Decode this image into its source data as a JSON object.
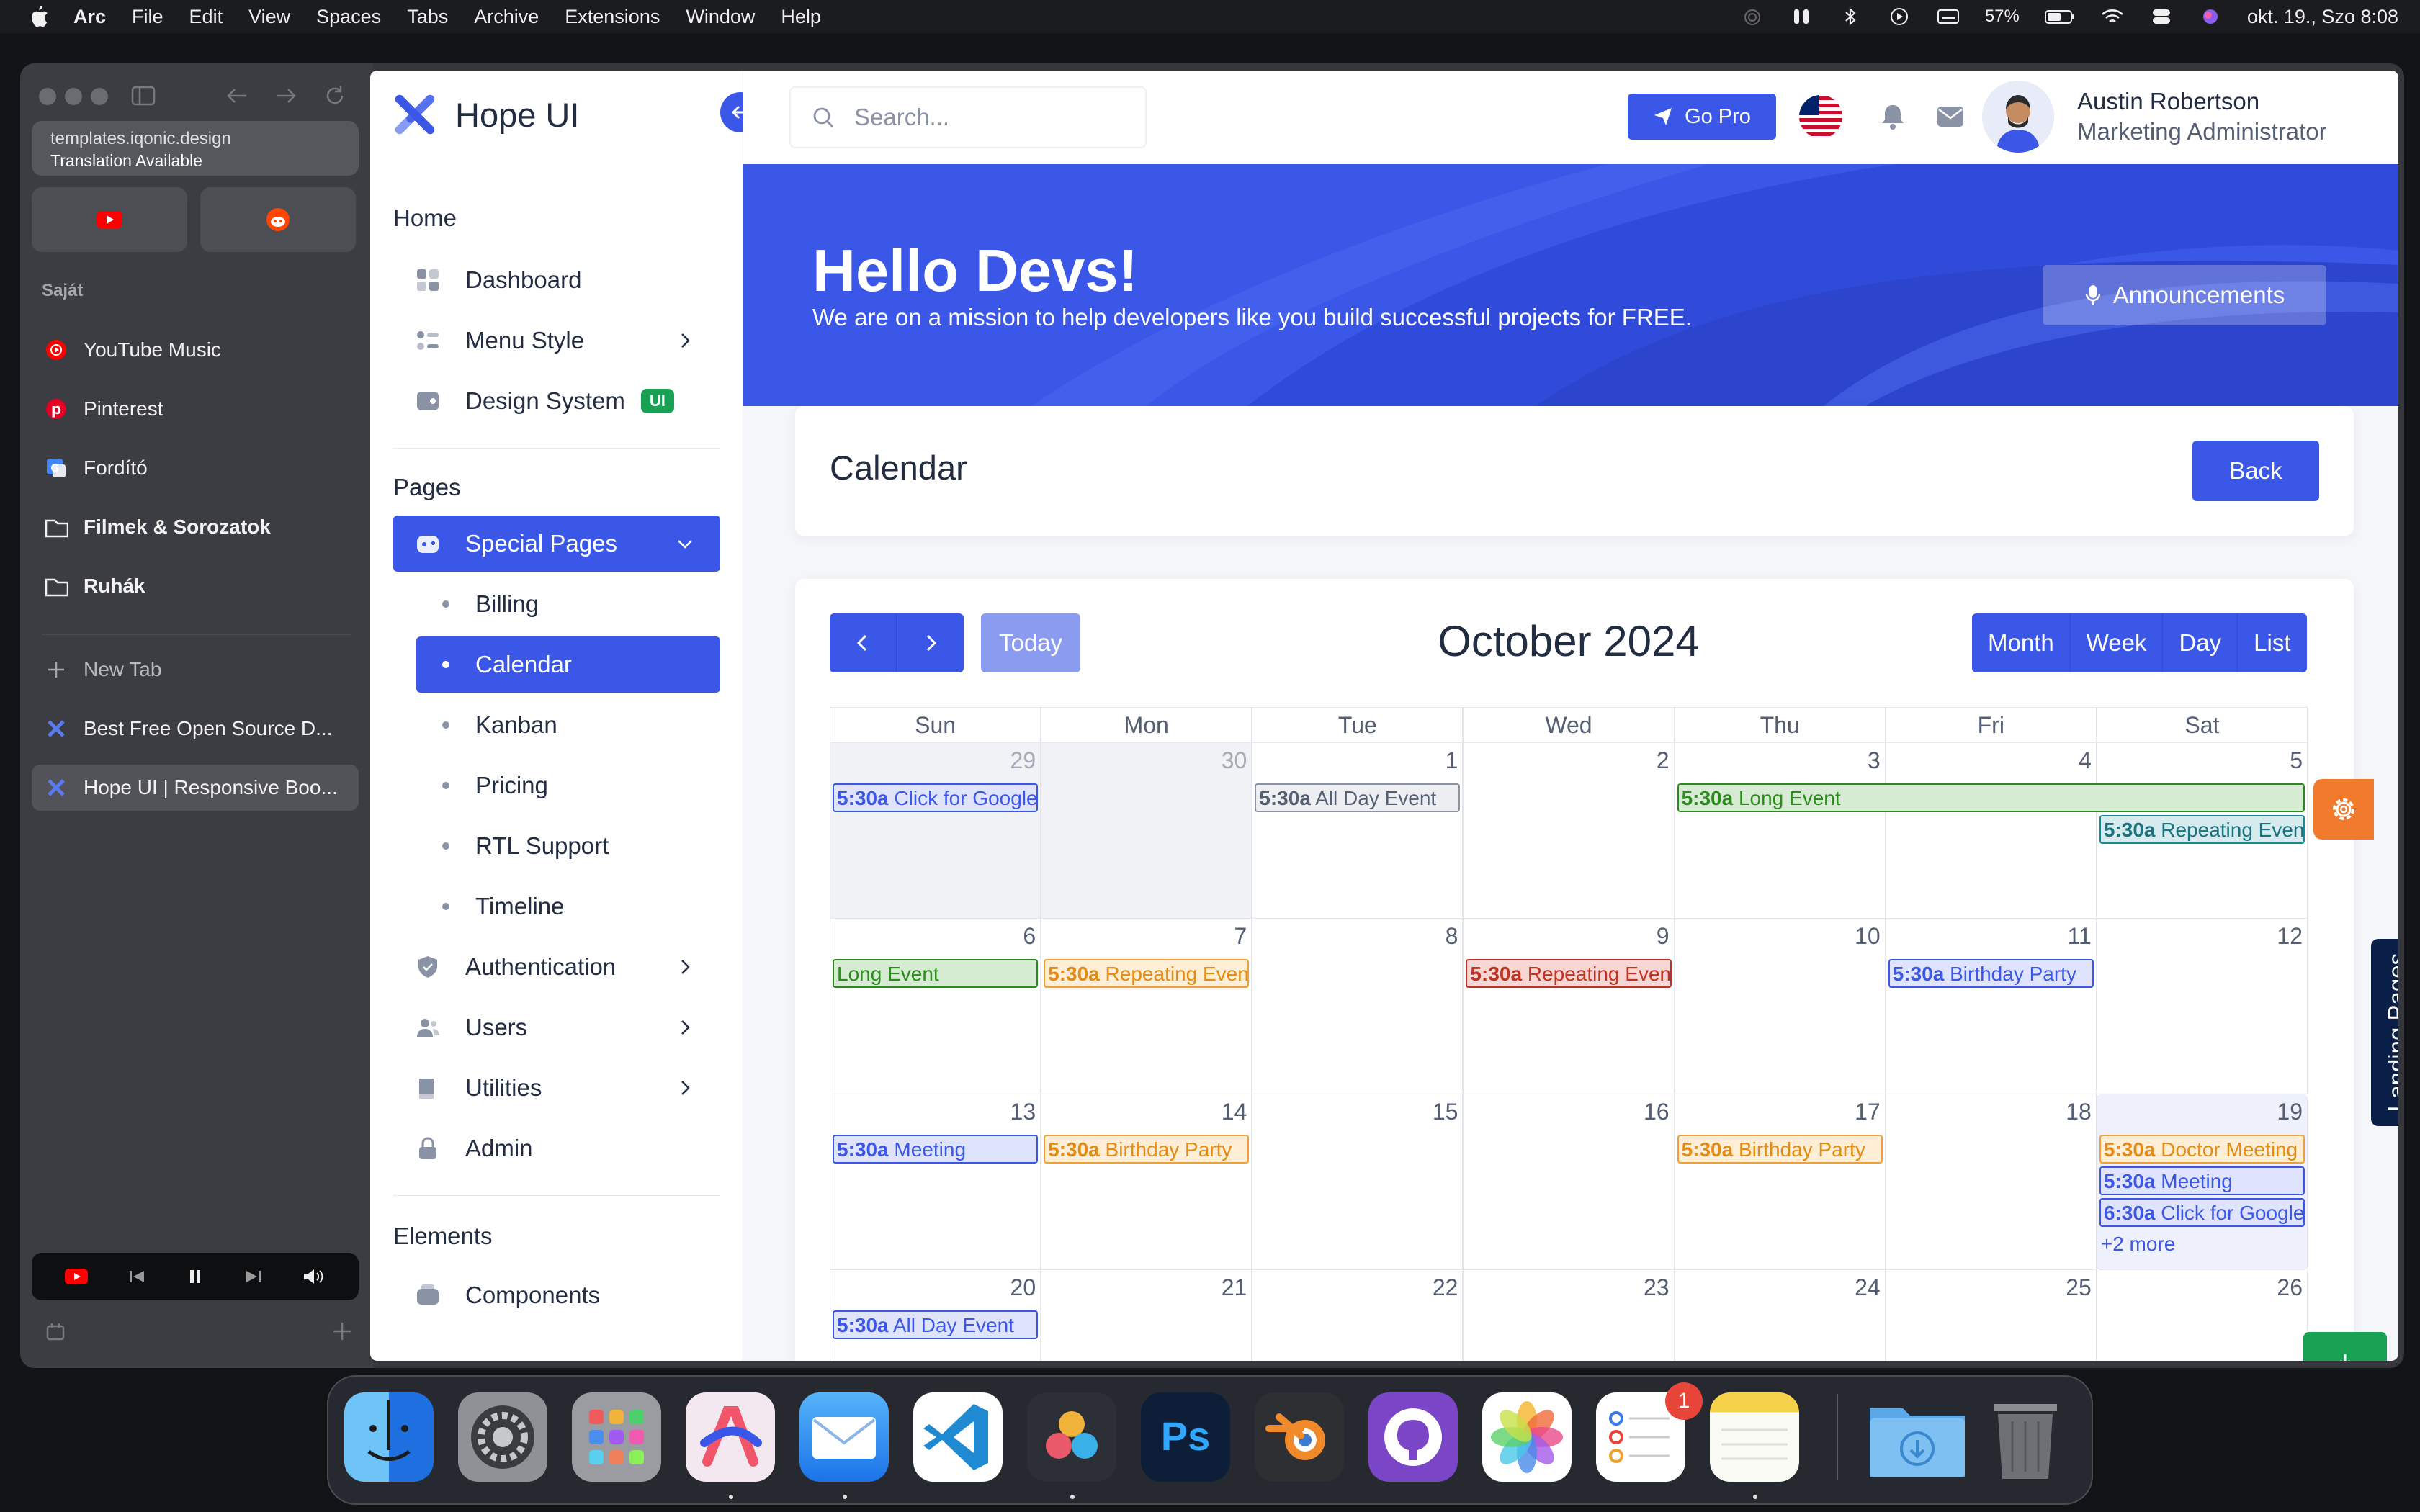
{
  "menubar": {
    "app": "Arc",
    "items": [
      "File",
      "Edit",
      "View",
      "Spaces",
      "Tabs",
      "Archive",
      "Extensions",
      "Window",
      "Help"
    ],
    "battery": "57%",
    "datetime": "okt. 19., Szo 8:08"
  },
  "arc": {
    "url": "templates.iqonic.design",
    "url_note": "Translation Available",
    "section": "Saját",
    "favorites": [
      {
        "label": "YouTube Music",
        "icon": "youtube-music-icon"
      },
      {
        "label": "Pinterest",
        "icon": "pinterest-icon"
      },
      {
        "label": "Fordító",
        "icon": "google-translate-icon"
      }
    ],
    "folders": [
      "Filmek & Sorozatok",
      "Ruhák"
    ],
    "new_tab": "New Tab",
    "tabs": [
      "Best Free Open Source D...",
      "Hope UI | Responsive Boo..."
    ]
  },
  "app": {
    "brand": "Hope UI",
    "search_placeholder": "Search...",
    "go_pro": "Go Pro",
    "user_name": "Austin Robertson",
    "user_role": "Marketing Administrator"
  },
  "nav": {
    "home_heading": "Home",
    "home_items": [
      "Dashboard",
      "Menu Style",
      "Design System"
    ],
    "design_badge": "UI",
    "pages_heading": "Pages",
    "special": "Special Pages",
    "sub_items": [
      "Billing",
      "Calendar",
      "Kanban",
      "Pricing",
      "RTL Support",
      "Timeline"
    ],
    "more_items": [
      "Authentication",
      "Users",
      "Utilities",
      "Admin"
    ],
    "elements_heading": "Elements",
    "components": "Components"
  },
  "hero": {
    "title": "Hello Devs!",
    "subtitle": "We are on a mission to help developers like you build successful projects for FREE.",
    "announcements": "Announcements"
  },
  "calendar": {
    "title": "Calendar",
    "back": "Back",
    "today": "Today",
    "month": "October 2024",
    "views": [
      "Month",
      "Week",
      "Day",
      "List"
    ],
    "days": [
      "Sun",
      "Mon",
      "Tue",
      "Wed",
      "Thu",
      "Fri",
      "Sat"
    ],
    "weeks": [
      [
        "29",
        "30",
        "1",
        "2",
        "3",
        "4",
        "5"
      ],
      [
        "6",
        "7",
        "8",
        "9",
        "10",
        "11",
        "12"
      ],
      [
        "13",
        "14",
        "15",
        "16",
        "17",
        "18",
        "19"
      ],
      [
        "20",
        "21",
        "22",
        "23",
        "24",
        "25",
        "26"
      ]
    ],
    "events": [
      {
        "row": 0,
        "col": 0,
        "span": 1,
        "slot": 0,
        "time": "5:30a",
        "title": "Click for Google",
        "color": "blue"
      },
      {
        "row": 0,
        "col": 2,
        "span": 1,
        "slot": 0,
        "time": "5:30a",
        "title": "All Day Event",
        "color": "gray"
      },
      {
        "row": 0,
        "col": 4,
        "span": 3,
        "slot": 0,
        "time": "5:30a",
        "title": "Long Event",
        "color": "green"
      },
      {
        "row": 0,
        "col": 6,
        "span": 1,
        "slot": 1,
        "time": "5:30a",
        "title": "Repeating Event",
        "color": "teal"
      },
      {
        "row": 1,
        "col": 0,
        "span": 1,
        "slot": 0,
        "time": "",
        "title": "Long Event",
        "color": "green"
      },
      {
        "row": 1,
        "col": 1,
        "span": 1,
        "slot": 0,
        "time": "5:30a",
        "title": "Repeating Event",
        "color": "orange"
      },
      {
        "row": 1,
        "col": 3,
        "span": 1,
        "slot": 0,
        "time": "5:30a",
        "title": "Repeating Event",
        "color": "red"
      },
      {
        "row": 1,
        "col": 5,
        "span": 1,
        "slot": 0,
        "time": "5:30a",
        "title": "Birthday Party",
        "color": "blue"
      },
      {
        "row": 2,
        "col": 0,
        "span": 1,
        "slot": 0,
        "time": "5:30a",
        "title": "Meeting",
        "color": "blue"
      },
      {
        "row": 2,
        "col": 1,
        "span": 1,
        "slot": 0,
        "time": "5:30a",
        "title": "Birthday Party",
        "color": "orange"
      },
      {
        "row": 2,
        "col": 4,
        "span": 1,
        "slot": 0,
        "time": "5:30a",
        "title": "Birthday Party",
        "color": "orange"
      },
      {
        "row": 2,
        "col": 6,
        "span": 1,
        "slot": 0,
        "time": "5:30a",
        "title": "Doctor Meeting",
        "color": "orange"
      },
      {
        "row": 2,
        "col": 6,
        "span": 1,
        "slot": 1,
        "time": "5:30a",
        "title": "Meeting",
        "color": "blue"
      },
      {
        "row": 2,
        "col": 6,
        "span": 1,
        "slot": 2,
        "time": "6:30a",
        "title": "Click for Google",
        "color": "blue"
      },
      {
        "row": 3,
        "col": 0,
        "span": 1,
        "slot": 0,
        "time": "5:30a",
        "title": "All Day Event",
        "color": "blue"
      }
    ],
    "more_label": "+2 more"
  },
  "landing_pages": "Landing Pages",
  "dock": {
    "reminders_badge": "1"
  },
  "colors": {
    "primary": "#3a57e8",
    "success": "#1aa053",
    "warning": "#f27a2d",
    "dark": "#232d42"
  }
}
